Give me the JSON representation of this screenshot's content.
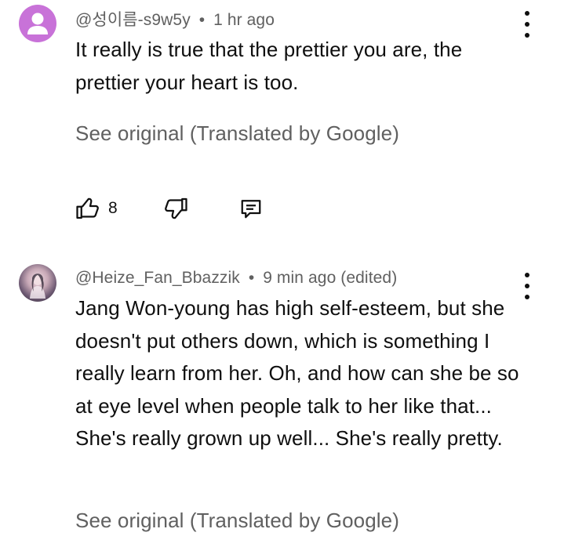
{
  "comments": [
    {
      "author": "@성이름-s9w5y",
      "time": "1 hr ago",
      "edited": "",
      "text": "It really is true that the prettier you are, the prettier your heart is too.",
      "translate_label": "See original (Translated by Google)",
      "likes": "8",
      "avatar_color": "#c872d8"
    },
    {
      "author": "@Heize_Fan_Bbazzik",
      "time": "9 min ago",
      "edited": "(edited)",
      "text": "Jang Won-young has high self-esteem, but she doesn't put others down, which is something I really learn from her. Oh, and how can she be so at eye level when people talk to her like that... She's really grown up well... She's really pretty.",
      "translate_label": "See original (Translated by Google)"
    }
  ],
  "separator": "•",
  "icons": {
    "like": "thumbs-up-icon",
    "dislike": "thumbs-down-icon",
    "reply": "reply-comment-icon",
    "more": "more-vertical-icon",
    "avatar_default": "person-icon"
  }
}
